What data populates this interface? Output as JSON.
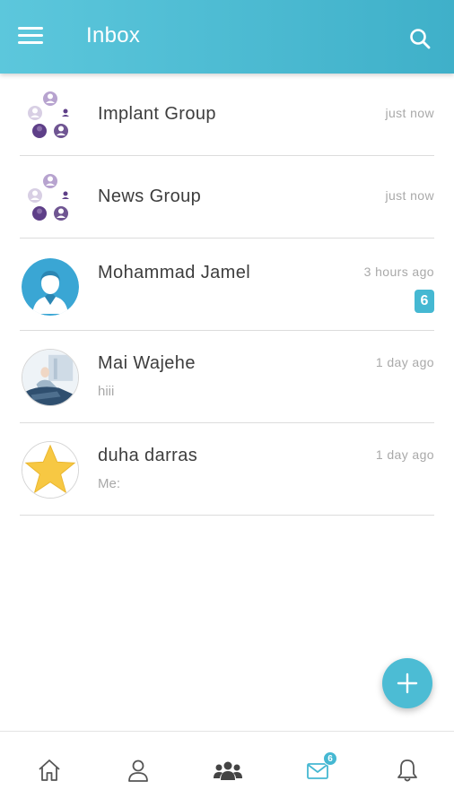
{
  "header": {
    "title": "Inbox"
  },
  "conversations": [
    {
      "name": "Implant Group",
      "time": "just now",
      "preview": "",
      "badge": ""
    },
    {
      "name": "News Group",
      "time": "just now",
      "preview": "",
      "badge": ""
    },
    {
      "name": "Mohammad Jamel",
      "time": "3 hours ago",
      "preview": "",
      "badge": "6"
    },
    {
      "name": "Mai Wajehe",
      "time": "1 day ago",
      "preview": "hiii",
      "badge": ""
    },
    {
      "name": "duha darras",
      "time": "1 day ago",
      "preview": "Me:",
      "badge": ""
    }
  ],
  "bottom_nav": {
    "items": [
      "home-icon",
      "profile-icon",
      "groups-icon",
      "messages-icon",
      "notifications-icon"
    ],
    "messages_badge": "6",
    "active": "messages-icon"
  },
  "colors": {
    "accent": "#45b8d2",
    "header_start": "#5cc7dc",
    "header_end": "#3fb0c9",
    "star": "#f7c843"
  }
}
